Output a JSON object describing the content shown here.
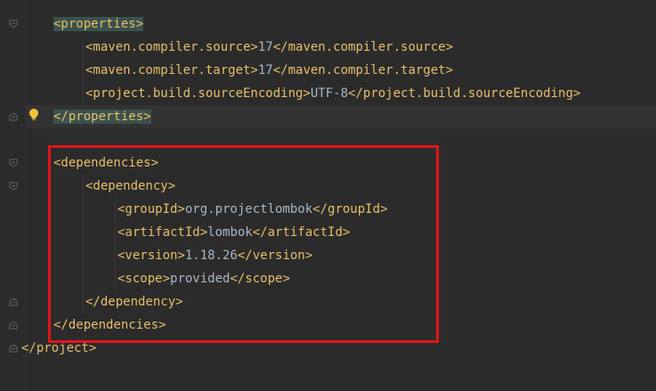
{
  "editor": {
    "lines": [
      {
        "indent": 1,
        "parts": [
          {
            "t": "tag",
            "v": "<properties>"
          }
        ],
        "match": true
      },
      {
        "indent": 2,
        "parts": [
          {
            "t": "tag",
            "v": "<maven.compiler.source>"
          },
          {
            "t": "txt",
            "v": "17"
          },
          {
            "t": "tag",
            "v": "</maven.compiler.source>"
          }
        ]
      },
      {
        "indent": 2,
        "parts": [
          {
            "t": "tag",
            "v": "<maven.compiler.target>"
          },
          {
            "t": "txt",
            "v": "17"
          },
          {
            "t": "tag",
            "v": "</maven.compiler.target>"
          }
        ]
      },
      {
        "indent": 2,
        "parts": [
          {
            "t": "tag",
            "v": "<project.build.sourceEncoding>"
          },
          {
            "t": "txt",
            "v": "UTF-8"
          },
          {
            "t": "tag",
            "v": "</project.build.sourceEncoding>"
          }
        ]
      },
      {
        "indent": 1,
        "parts": [
          {
            "t": "tag",
            "v": "</properties>"
          }
        ],
        "match": true,
        "current": true
      },
      {
        "indent": 0,
        "parts": []
      },
      {
        "indent": 1,
        "parts": [
          {
            "t": "tag",
            "v": "<dependencies>"
          }
        ]
      },
      {
        "indent": 2,
        "parts": [
          {
            "t": "tag",
            "v": "<dependency>"
          }
        ]
      },
      {
        "indent": 3,
        "parts": [
          {
            "t": "tag",
            "v": "<groupId>"
          },
          {
            "t": "txt",
            "v": "org.projectlombok"
          },
          {
            "t": "tag",
            "v": "</groupId>"
          }
        ]
      },
      {
        "indent": 3,
        "parts": [
          {
            "t": "tag",
            "v": "<artifactId>"
          },
          {
            "t": "txt",
            "v": "lombok"
          },
          {
            "t": "tag",
            "v": "</artifactId>"
          }
        ]
      },
      {
        "indent": 3,
        "parts": [
          {
            "t": "tag",
            "v": "<version>"
          },
          {
            "t": "txt",
            "v": "1.18.26"
          },
          {
            "t": "tag",
            "v": "</version>"
          }
        ]
      },
      {
        "indent": 3,
        "parts": [
          {
            "t": "tag",
            "v": "<scope>"
          },
          {
            "t": "txt",
            "v": "provided"
          },
          {
            "t": "tag",
            "v": "</scope>"
          }
        ]
      },
      {
        "indent": 2,
        "parts": [
          {
            "t": "tag",
            "v": "</dependency>"
          }
        ]
      },
      {
        "indent": 1,
        "parts": [
          {
            "t": "tag",
            "v": "</dependencies>"
          }
        ]
      },
      {
        "indent": 0,
        "parts": [
          {
            "t": "tag",
            "v": "</project>"
          }
        ]
      }
    ]
  },
  "colors": {
    "background": "#2b2b2b",
    "tag": "#e8bf6a",
    "text": "#a9b7c6",
    "tag_match_highlight": "#3b514d",
    "annotation_box": "#e0141a",
    "bulb": "#f0c23a"
  },
  "icons": [
    "fold-open-icon",
    "fold-close-icon",
    "intention-bulb-icon"
  ]
}
